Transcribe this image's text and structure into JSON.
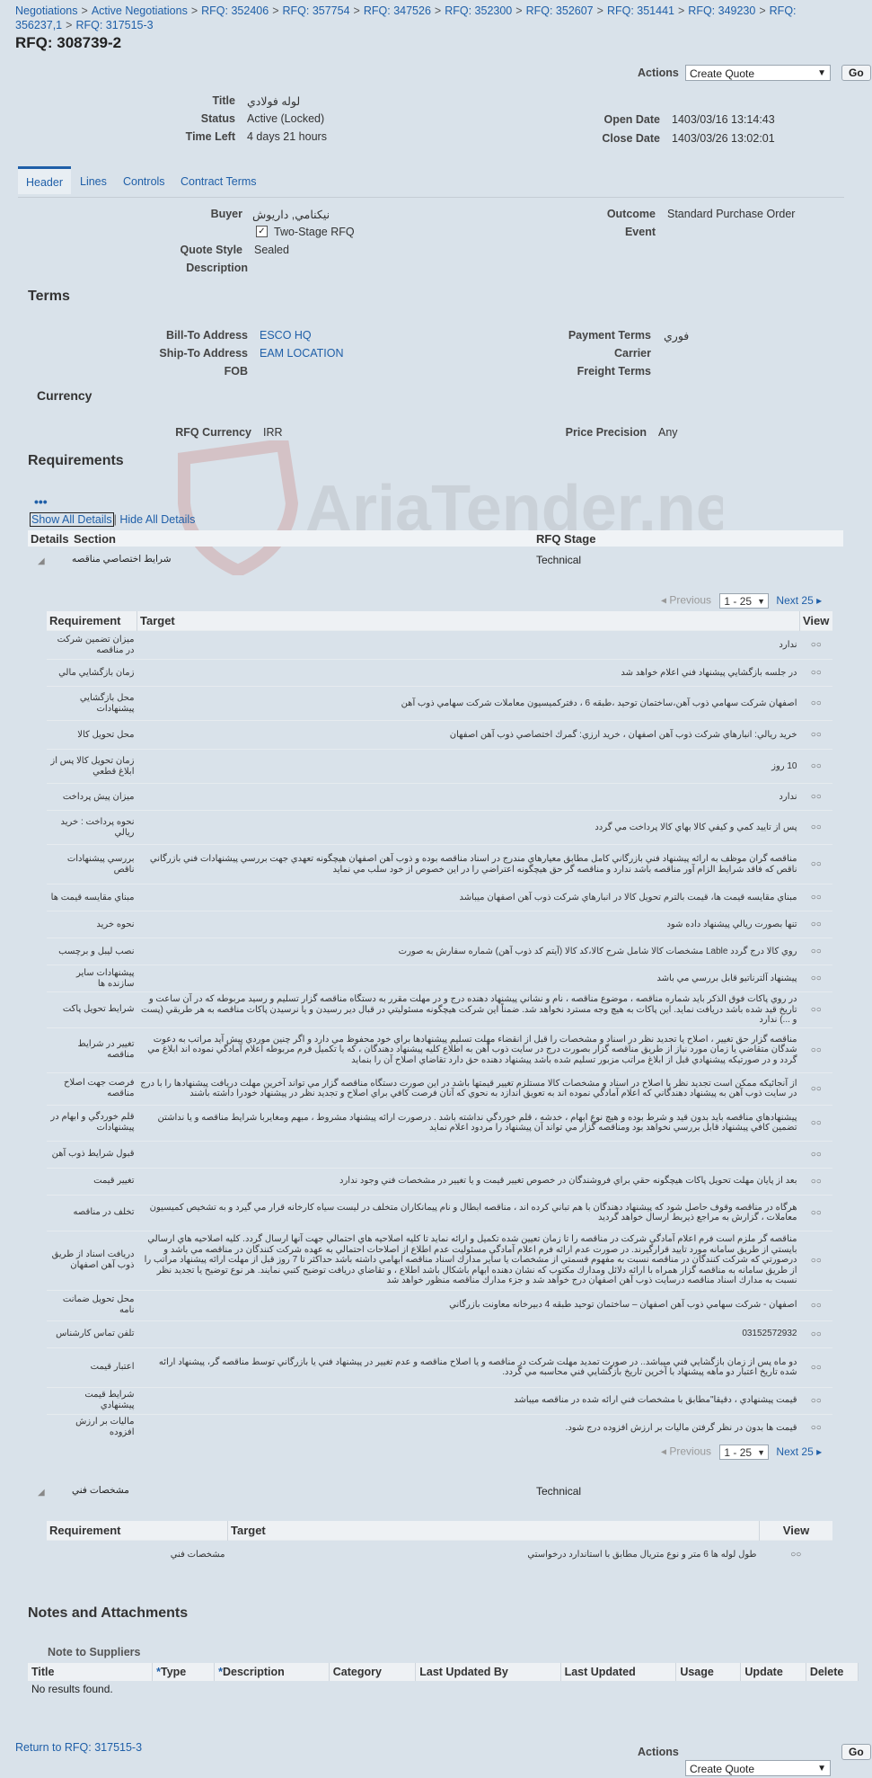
{
  "breadcrumbs": [
    "Negotiations",
    "Active Negotiations",
    "RFQ: 352406",
    "RFQ: 357754",
    "RFQ: 347526",
    "RFQ: 352300",
    "RFQ: 352607",
    "RFQ: 351441",
    "RFQ: 349230",
    "RFQ: 356237,1",
    "RFQ: 317515-3"
  ],
  "page_title": "RFQ: 308739-2",
  "actions": {
    "label": "Actions",
    "selected": "Create Quote",
    "go": "Go"
  },
  "summary": {
    "title_label": "Title",
    "title_value": "لوله فولادي",
    "status_label": "Status",
    "status_value": "Active (Locked)",
    "time_left_label": "Time Left",
    "time_left_value": "4 days 21 hours",
    "open_date_label": "Open Date",
    "open_date_value": "1403/03/16 13:14:43",
    "close_date_label": "Close Date",
    "close_date_value": "1403/03/26 13:02:01"
  },
  "tabs": [
    "Header",
    "Lines",
    "Controls",
    "Contract Terms"
  ],
  "header_info": {
    "buyer_label": "Buyer",
    "buyer_value": "نيكنامي, داريوش",
    "two_stage_label": "Two-Stage RFQ",
    "quote_style_label": "Quote Style",
    "quote_style_value": "Sealed",
    "description_label": "Description",
    "outcome_label": "Outcome",
    "outcome_value": "Standard Purchase Order",
    "event_label": "Event"
  },
  "terms": {
    "heading": "Terms",
    "bill_to_label": "Bill-To Address",
    "bill_to_value": "ESCO HQ",
    "ship_to_label": "Ship-To Address",
    "ship_to_value": "EAM LOCATION",
    "fob_label": "FOB",
    "payment_terms_label": "Payment Terms",
    "payment_terms_value": "فوري",
    "carrier_label": "Carrier",
    "freight_terms_label": "Freight Terms"
  },
  "currency": {
    "heading": "Currency",
    "rfq_currency_label": "RFQ Currency",
    "rfq_currency_value": "IRR",
    "price_precision_label": "Price Precision",
    "price_precision_value": "Any"
  },
  "requirements": {
    "heading": "Requirements",
    "show_all": "Show All Details",
    "hide_all": "Hide All Details",
    "col_details": "Details",
    "col_section": "Section",
    "col_stage": "RFQ Stage",
    "col_requirement": "Requirement",
    "col_target": "Target",
    "col_view": "View",
    "view_glyph": "○○",
    "pager": {
      "previous": "Previous",
      "range": "1 - 25",
      "next": "Next 25"
    },
    "sections": [
      {
        "name": "شرايط اختصاصي مناقصه",
        "stage": "Technical",
        "rows": [
          {
            "req": "ميزان تضمين شركت در مناقصه",
            "target": "ندارد"
          },
          {
            "req": "زمان بازگشايي مالي",
            "target": "در جلسه بازگشايي پيشنهاد فني اعلام خواهد شد"
          },
          {
            "req": "محل بازگشايي پيشنهادات",
            "target": "اصفهان شركت سهامي ذوب آهن،ساختمان توحيد ،طبقه 6 ، دفتركميسيون معاملات شركت سهامي ذوب آهن"
          },
          {
            "req": "محل تحويل كالا",
            "target": "خريد ريالي: انبارهاي شركت ذوب آهن اصفهان ، خريد ارزي: گمرك اختصاصي ذوب آهن اصفهان"
          },
          {
            "req": "زمان تحويل كالا پس از ابلاغ قطعي",
            "target": "10 روز"
          },
          {
            "req": "ميزان پيش پرداخت",
            "target": "ندارد"
          },
          {
            "req": "نحوه پرداخت : خريد ريالي",
            "target": "پس از تاييد كمي و كيفي كالا بهاي كالا پرداخت مي گردد"
          },
          {
            "req": "بررسي پيشنهادات ناقص",
            "target": "مناقصه گران موظف به ارائه پيشنهاد فني بازرگاني كامل مطابق معيارهاي مندرج در اسناد مناقصه بوده و ذوب آهن اصفهان هيچگونه تعهدي جهت بررسي پيشنهادات فني بازرگاني ناقص كه فاقد شرايط الزام آور مناقصه باشد ندارد و مناقصه گر حق هيچگونه اعتراضي را در اين خصوص از خود سلب مي نمايد"
          },
          {
            "req": "مبناي مقايسه قيمت ها",
            "target": "مبناي مقايسه قيمت ها، قيمت بالترم تحويل كالا در انبارهاي شركت ذوب آهن اصفهان ميباشد"
          },
          {
            "req": "نحوه خريد",
            "target": "تنها بصورت ريالي پيشنهاد داده شود"
          },
          {
            "req": "نصب ليبل و برچسب",
            "target": "روي كالا درج گردد Lable مشخصات كالا شامل شرح كالا،كد كالا (آيتم كد ذوب آهن) شماره سفارش به صورت"
          },
          {
            "req": "پيشنهادات ساير سازنده ها",
            "target": "پيشنهاد آلترناتيو قابل بررسي مي باشد"
          },
          {
            "req": "شرايط تحويل پاكت",
            "target": "در روي پاكات فوق الذكر بايد شماره مناقصه ، موضوع مناقصه ، نام و نشاني پيشنهاد دهنده درج و در مهلت مقرر به دستگاه مناقصه گزار تسليم و رسيد مربوطه كه در آن ساعت و تاريخ قيد شده باشد دريافت نمايد. اين پاكات به هيچ وجه مسترد نخواهد شد. ضمناً اين شركت هيچگونه مسئوليتي در قبال دير رسيدن و يا نرسيدن پاكات مناقصه به هر طريقي (پست و ...) ندارد"
          },
          {
            "req": "تغيير در شرايط مناقصه",
            "target": "مناقصه گزار حق تغيير ، اصلاح يا تجديد نظر در اسناد و مشخصات را قبل از انقضاء مهلت تسليم پيشنهادها براي خود محفوظ مي دارد و اگر چنين موردي پيش آيد مراتب به دعوت شدگان متقاضي يا زمان مورد نياز از طريق مناقصه گزار بصورت درج در سايت ذوب آهن به اطلاع كليه پيشنهاد دهندگان ، كه يا تكميل فرم مربوطه اعلام آمادگي نموده اند ابلاغ مي گردد و در صورتيكه پيشنهادي قبل از ابلاغ مراتب مزبور تسليم شده باشد پيشنهاد دهنده حق دارد تقاضاي اصلاح آن را بنمايد"
          },
          {
            "req": "فرصت جهت اصلاح مناقصه",
            "target": "از آنجائيكه ممكن است تجديد نظر يا اصلاح در اسناد و مشخصات كالا مستلزم تغيير قيمتها باشد در اين صورت دستگاه مناقصه گزار مي تواند آخرين مهلت دريافت پيشنهادها را با درج در سايت ذوب آهن به پيشنهاد دهندگاني كه اعلام آمادگي نموده اند به تعويق اندازد به نحوي كه آنان فرصت كافي براي اصلاح و تجديد نظر در پيشنهاد خودرا داشته باشند"
          },
          {
            "req": "قلم خوردگي و ابهام در پيشنهادات",
            "target": "پيشنهادهاي مناقصه بايد بدون قيد و شرط بوده و هيچ نوع ابهام ، خدشه ، قلم خوردگي نداشته باشد . درصورت ارائه پيشنهاد مشروط ، مبهم ومغايربا شرايط مناقصه و يا نداشتن تضمين كافي پيشنهاد قابل بررسي نخواهد بود ومناقصه گزار مي تواند آن پيشنهاد را مردود اعلام نمايد"
          },
          {
            "req": "قبول شرايط ذوب آهن",
            "target": ""
          },
          {
            "req": "تغيير قيمت",
            "target": "بعد از پايان مهلت تحويل پاكات هيچگونه حقي براي فروشندگان در خصوص تغيير قيمت و يا تغيير در مشخصات فني وجود ندارد"
          },
          {
            "req": "تخلف در مناقصه",
            "target": "هرگاه در مناقصه وقوف حاصل شود كه پيشنهاد دهندگان با هم تباني كرده اند ، مناقصه ابطال و نام پيمانكاران متخلف در ليست سياه كارخانه قرار مي گيرد و به تشخيص كميسيون معاملات ، گزارش به مراجع ذيربط ارسال خواهد گرديد"
          },
          {
            "req": "دريافت اسناد از طريق ذوب آهن اصفهان",
            "target": "مناقصه گر ملزم است فرم اعلام آمادگي شركت در مناقصه را تا زمان تعيين شده تكميل و ارائه نمايد تا كليه اصلاحيه هاي احتمالي جهت آنها ارسال گردد. كليه اصلاحيه هاي ارسالي بايستي از طريق سامانه مورد تاييد قرارگيرند. در صورت عدم ارائه فرم اعلام آمادگي مسئوليت عدم اطلاع از اصلاحات احتمالي به عهده شركت كنندگان در مناقصه مي باشد و درصورتي كه شركت كنندگان در مناقصه نسبت به مفهوم قسمتي از مشخصات يا ساير مدارك اسناد مناقصه ابهامي داشته باشد حداكثر تا 7 روز قبل از مهلت ارائه پيشنهاد مراتب را از طريق سامانه به مناقصه گزار همراه با ارائه دلائل ومدارك مكتوب كه نشان دهنده ابهام باشكال باشد اطلاع ، و تقاضاي دريافت توضيح كتبي نمايند. هر نوع توضيح يا تجديد نظر نسبت به مدارك اسناد مناقصه درسايت ذوب آهن اصفهان درج خواهد شد و جزء مدارك مناقصه منظور خواهد شد"
          },
          {
            "req": "محل تحويل ضمانت نامه",
            "target": "اصفهان - شركت سهامي ذوب آهن اصفهان – ساختمان توحيد طبقه 4 دبيرخانه معاونت بازرگاني"
          },
          {
            "req": "تلفن تماس كارشناس",
            "target": "03152572932"
          },
          {
            "req": "اعتبار قيمت",
            "target": "دو ماه پس از زمان بازگشايي فني ميباشد.. در صورت تمديد مهلت شركت در مناقصه و يا اصلاح مناقصه و عدم تغيير در پيشنهاد فني يا بازرگاني توسط مناقصه گر، پيشنهاد ارائه شده تاريخ اعتبار دو ماهه پيشنهاد با آخرين تاريخ بازگشايي فني محاسبه مي گردد."
          },
          {
            "req": "شرايط قيمت پيشنهادي",
            "target": "قيمت پيشنهادي ، دقيقا\"مطابق با مشخصات فني ارائه شده در مناقصه ميباشد"
          },
          {
            "req": "ماليات بر ارزش افزوده",
            "target": "قيمت ها بدون در نظر گرفتن ماليات بر ارزش افزوده درج شود."
          }
        ]
      },
      {
        "name": "مشخصات فني",
        "stage": "Technical",
        "rows": [
          {
            "req": "مشخصات فني",
            "target": "طول لوله ها 6 متر و نوع متريال مطابق با استاندارد درخواستي"
          }
        ]
      }
    ]
  },
  "notes": {
    "heading": "Notes and Attachments",
    "note_to_suppliers": "Note to Suppliers",
    "columns": [
      "Title",
      "Type",
      "Description",
      "Category",
      "Last Updated By",
      "Last Updated",
      "Usage",
      "Update",
      "Delete"
    ],
    "empty": "No results found."
  },
  "footer": {
    "return_link": "Return to RFQ: 317515-3"
  },
  "watermark_text": "AriaTender.neT"
}
